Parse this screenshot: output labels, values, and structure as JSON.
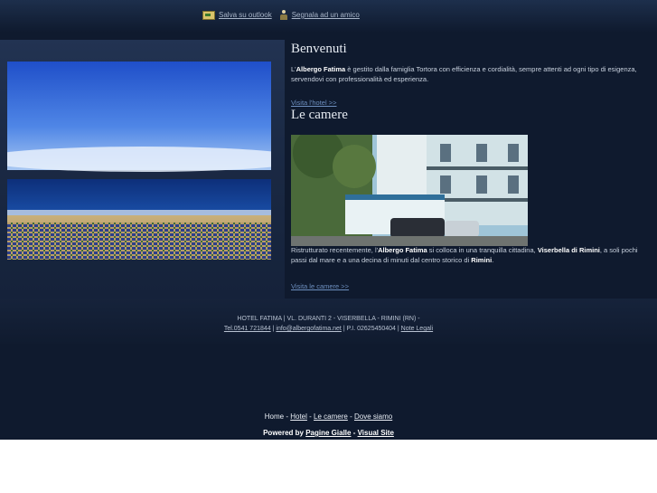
{
  "toplinks": {
    "save": "Salva su outlook",
    "share": "Segnala ad un amico"
  },
  "welcome": {
    "title": "Benvenuti",
    "p1": "L'",
    "name": "Albergo Fatima",
    "p2": " è gestito dalla famiglia Tortora con efficienza e cordialità, sempre attenti ad ogni tipo di esigenza, servendovi con professionalità ed esperienza.",
    "link": "Visita l'hotel >>"
  },
  "rooms": {
    "title": "Le camere",
    "p1": "Ristrutturato recentemente, l'",
    "name": "Albergo Fatima",
    "p2": " si colloca in una tranquilla cittadina, ",
    "town": "Viserbella di Rimini",
    "p3": ", a soli pochi passi dal mare e a una decina di minuti dal centro storico di ",
    "city": "Rimini",
    "p4": ".",
    "link": "Visita le camere >>"
  },
  "footer": {
    "address": "HOTEL FATIMA | VL. DURANTI 2 - VISERBELLA - RIMINI (RN) -",
    "tel": "Tel.0541 721844",
    "sep1": " | ",
    "email": "info@albergofatima.net",
    "piva": " | P.I. 02625450404 | ",
    "legal": "Note Legali"
  },
  "nav": {
    "home": "Home",
    "sep": " - ",
    "hotel": "Hotel",
    "rooms": "Le camere",
    "where": "Dove siamo"
  },
  "powered": {
    "prefix": "Powered by ",
    "pg": "Pagine Gialle",
    "dash": " - ",
    "vs": "Visual Site"
  },
  "icons": {
    "save": "outlook-icon",
    "share": "person-icon"
  }
}
